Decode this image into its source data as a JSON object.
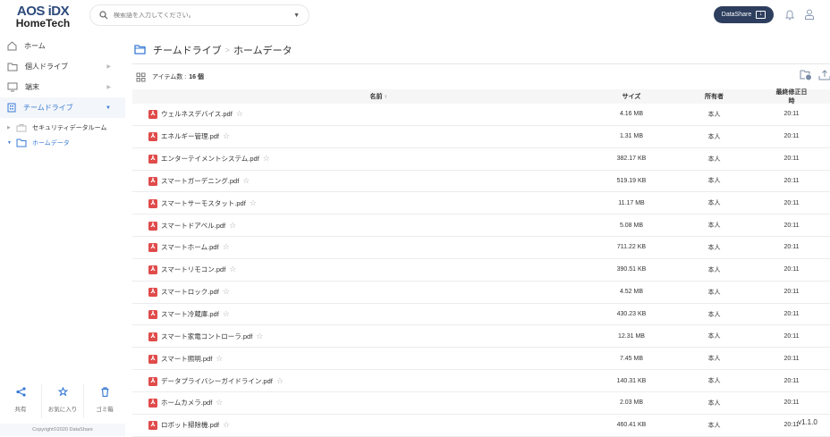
{
  "header": {
    "logo_line1": "AOS iDX",
    "logo_line2": "HomeTech",
    "search_placeholder": "検索語を入力してください。",
    "datashare_label": "DataShare"
  },
  "sidebar": {
    "items": [
      {
        "label": "ホーム"
      },
      {
        "label": "個人ドライブ"
      },
      {
        "label": "端末"
      },
      {
        "label": "チームドライブ"
      }
    ],
    "tree": [
      {
        "label": "セキュリティデータルーム"
      },
      {
        "label": "ホームデータ"
      }
    ],
    "bottom": [
      {
        "label": "共有"
      },
      {
        "label": "お気に入り"
      },
      {
        "label": "ゴミ箱"
      }
    ],
    "copyright": "Copyright©2020 DataShare"
  },
  "main": {
    "breadcrumb": [
      "チームドライブ",
      "ホームデータ"
    ],
    "item_count_label": "アイテム数 :",
    "item_count": "16 個",
    "columns": {
      "name": "名前",
      "size": "サイズ",
      "owner": "所有者",
      "modified": "最終修正日時"
    },
    "files": [
      {
        "name": "ウェルネスデバイス.pdf",
        "size": "4.16 MB",
        "owner": "本人",
        "time": "20:11"
      },
      {
        "name": "エネルギー管理.pdf",
        "size": "1.31 MB",
        "owner": "本人",
        "time": "20:11"
      },
      {
        "name": "エンターテイメントシステム.pdf",
        "size": "382.17 KB",
        "owner": "本人",
        "time": "20:11"
      },
      {
        "name": "スマートガーデニング.pdf",
        "size": "519.19 KB",
        "owner": "本人",
        "time": "20:11"
      },
      {
        "name": "スマートサーモスタット.pdf",
        "size": "11.17 MB",
        "owner": "本人",
        "time": "20:11"
      },
      {
        "name": "スマートドアベル.pdf",
        "size": "5.08 MB",
        "owner": "本人",
        "time": "20:11"
      },
      {
        "name": "スマートホーム.pdf",
        "size": "711.22 KB",
        "owner": "本人",
        "time": "20:11"
      },
      {
        "name": "スマートリモコン.pdf",
        "size": "390.51 KB",
        "owner": "本人",
        "time": "20:11"
      },
      {
        "name": "スマートロック.pdf",
        "size": "4.52 MB",
        "owner": "本人",
        "time": "20:11"
      },
      {
        "name": "スマート冷蔵庫.pdf",
        "size": "430.23 KB",
        "owner": "本人",
        "time": "20:11"
      },
      {
        "name": "スマート家電コントローラ.pdf",
        "size": "12.31 MB",
        "owner": "本人",
        "time": "20:11"
      },
      {
        "name": "スマート照明.pdf",
        "size": "7.45 MB",
        "owner": "本人",
        "time": "20:11"
      },
      {
        "name": "データプライバシーガイドライン.pdf",
        "size": "140.31 KB",
        "owner": "本人",
        "time": "20:11"
      },
      {
        "name": "ホームカメラ.pdf",
        "size": "2.03 MB",
        "owner": "本人",
        "time": "20:11"
      },
      {
        "name": "ロボット掃除機.pdf",
        "size": "460.41 KB",
        "owner": "本人",
        "time": "20:11"
      }
    ]
  },
  "version": "v1.1.0"
}
